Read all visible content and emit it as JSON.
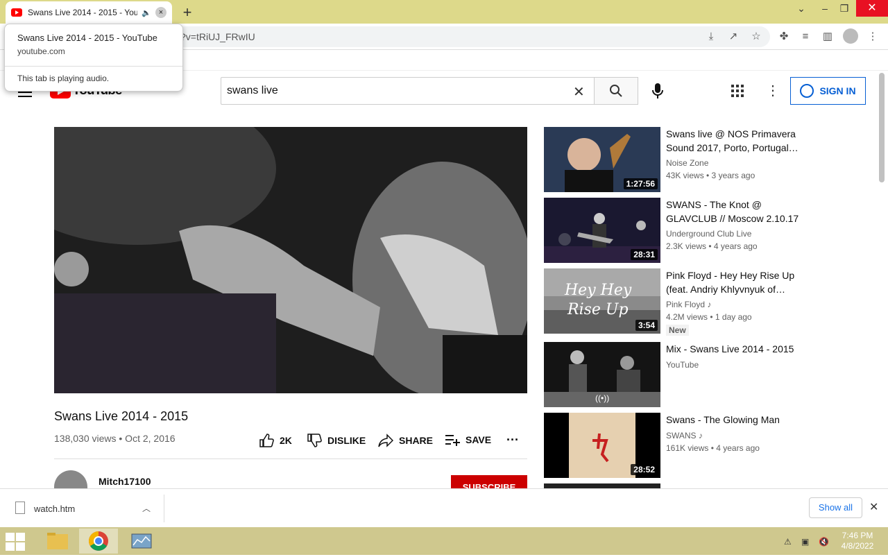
{
  "browser": {
    "tab_title": "Swans Live 2014 - 2015 - You",
    "tab_close": "×",
    "new_tab": "+",
    "url": "?v=tRiUJ_FRwIU",
    "popup": {
      "title": "Swans Live 2014 - 2015 - YouTube",
      "domain": "youtube.com",
      "status": "This tab is playing audio."
    }
  },
  "youtube": {
    "logo_text": "YouTube",
    "search_value": "swans live",
    "sign_in": "SIGN IN"
  },
  "video": {
    "title": "Swans Live 2014 - 2015",
    "views_date": "138,030 views • Oct 2, 2016",
    "likes": "2K",
    "dislike": "DISLIKE",
    "share": "SHARE",
    "save": "SAVE",
    "channel": "Mitch17100",
    "subscribe": "SUBSCRIBE"
  },
  "recommendations": [
    {
      "title": "Swans live @ NOS Primavera Sound 2017, Porto, Portugal…",
      "channel": "Noise Zone",
      "meta": "43K views • 3 years ago",
      "duration": "1:27:56",
      "music": false,
      "badge": ""
    },
    {
      "title": "SWANS - The Knot @ GLAVCLUB // Moscow 2.10.17",
      "channel": "Underground Club Live",
      "meta": "2.3K views • 4 years ago",
      "duration": "28:31",
      "music": false,
      "badge": ""
    },
    {
      "title": "Pink Floyd - Hey Hey Rise Up (feat. Andriy Khlyvnyuk of…",
      "channel": "Pink Floyd",
      "meta": "4.2M views • 1 day ago",
      "duration": "3:54",
      "music": true,
      "badge": "New"
    },
    {
      "title": "Mix - Swans Live 2014 - 2015",
      "channel": "YouTube",
      "meta": "",
      "duration": "",
      "music": false,
      "badge": ""
    },
    {
      "title": "Swans - The Glowing Man",
      "channel": "SWANS",
      "meta": "161K views • 4 years ago",
      "duration": "28:52",
      "music": true,
      "badge": ""
    }
  ],
  "thumb3_text": [
    "Hey Hey",
    "Rise Up"
  ],
  "download": {
    "filename": "watch.htm",
    "show_all": "Show all"
  },
  "taskbar": {
    "time": "7:46 PM",
    "date": "4/8/2022"
  }
}
